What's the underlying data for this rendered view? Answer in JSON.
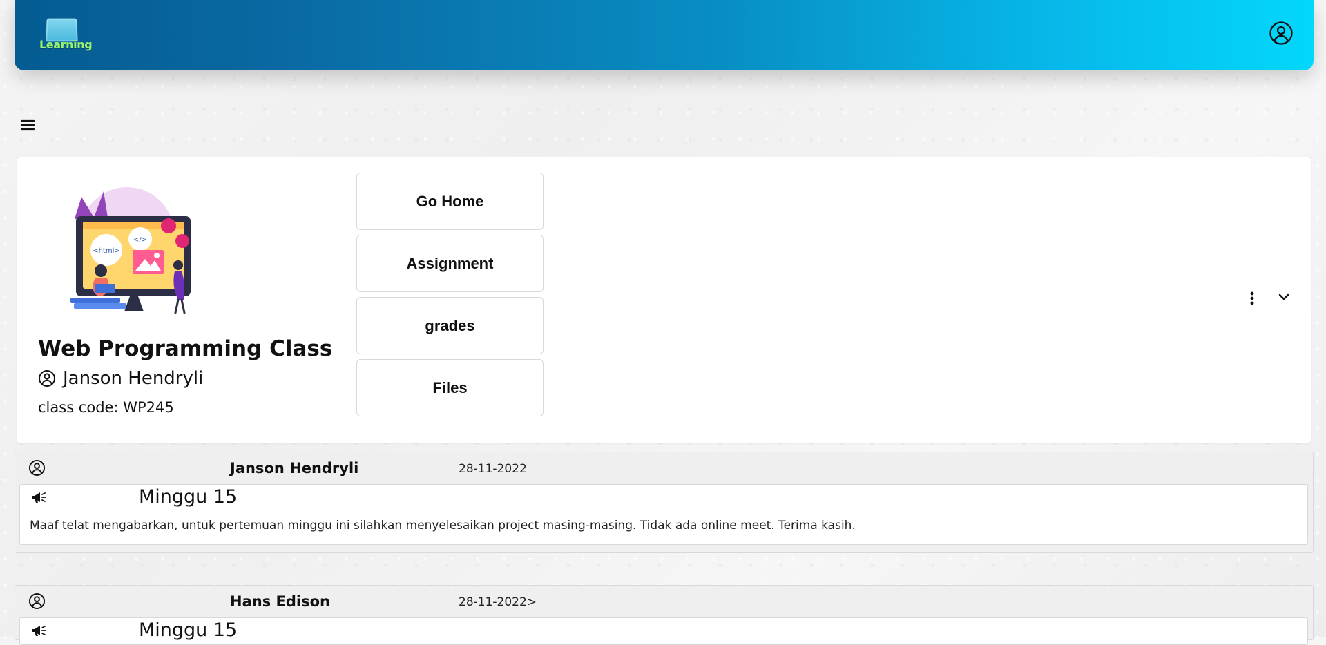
{
  "header": {
    "logo_text": "Learning",
    "profile_icon": "user-circle-icon",
    "gradient_colors": [
      "#045c91",
      "#03d7fb"
    ]
  },
  "navigation": {
    "menu_icon": "hamburger-menu-icon"
  },
  "class_card": {
    "title": "Web Programming Class",
    "teacher": "Janson Hendryli",
    "class_code": "class code: WP245",
    "illustration_labels": {
      "html_tag": "<html>",
      "code_tag": "</>"
    },
    "buttons": [
      {
        "label": "Go Home"
      },
      {
        "label": "Assignment"
      },
      {
        "label": "grades"
      },
      {
        "label": "Files"
      }
    ],
    "actions": {
      "more_icon": "vertical-dots-icon",
      "expand_icon": "chevron-down-icon"
    }
  },
  "posts": [
    {
      "author": "Janson Hendryli",
      "date": "28-11-2022",
      "title": "Minggu 15",
      "message": "Maaf telat mengabarkan, untuk pertemuan minggu ini silahkan menyelesaikan project masing-masing. Tidak ada online meet. Terima kasih."
    },
    {
      "author": "Hans Edison",
      "date": "28-11-2022>",
      "title": "Minggu 15"
    }
  ]
}
